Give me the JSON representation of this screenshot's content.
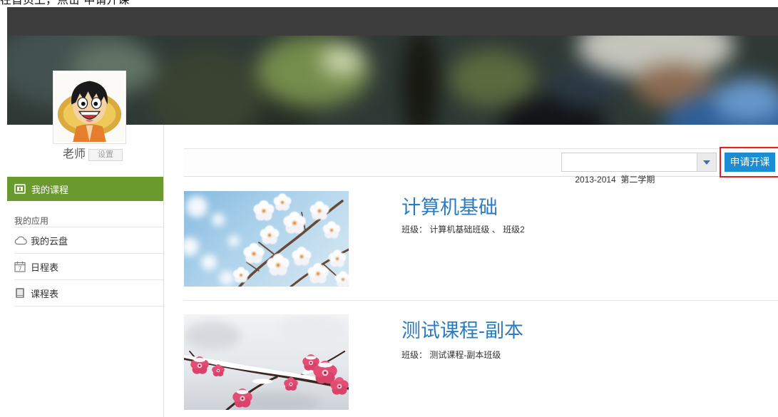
{
  "caption": "在首页上，点击“申请开课”",
  "user": {
    "name": "老师",
    "settings_label": "设置"
  },
  "sidebar": {
    "active_item": {
      "label": "我的课程",
      "icon": "course-icon"
    },
    "section_label": "我的应用",
    "items": [
      {
        "label": "我的云盘",
        "icon": "cloud-icon"
      },
      {
        "label": "日程表",
        "icon": "calendar-icon",
        "icon_glyph": "7"
      },
      {
        "label": "课程表",
        "icon": "book-icon"
      }
    ]
  },
  "toolbar": {
    "semester_select": {
      "value": "2013-2014  第二学期",
      "icon": "triangle-down-icon"
    },
    "apply_button_label": "申请开课"
  },
  "course_meta": {
    "classes_label": "班级：",
    "class_separator": "、"
  },
  "courses": [
    {
      "title": "计算机基础",
      "classes": [
        "计算机基础班级",
        "班级2"
      ]
    },
    {
      "title": "测试课程-副本",
      "classes": [
        "测试课程-副本班级"
      ]
    }
  ],
  "colors": {
    "top_bar": "#3d3d3d",
    "active_nav_green": "#6a9a2e",
    "course_title_blue": "#2b7bc0",
    "apply_button_blue": "#1b8ed3",
    "highlight_red": "#e0221e"
  }
}
